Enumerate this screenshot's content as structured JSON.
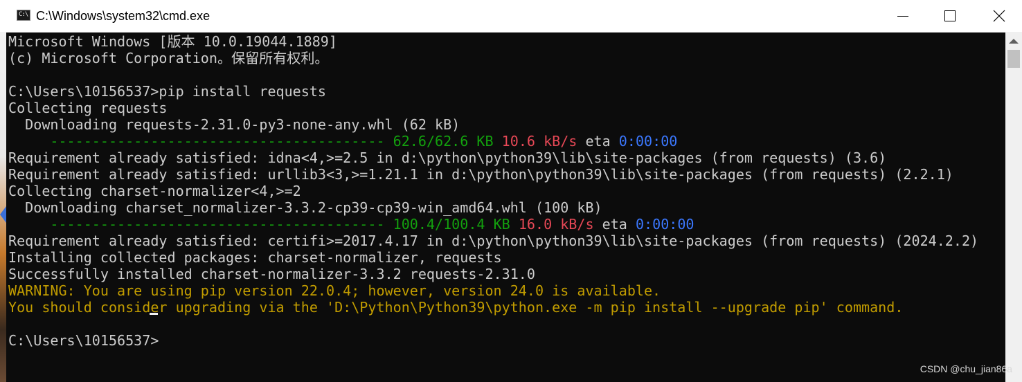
{
  "window": {
    "title": "C:\\Windows\\system32\\cmd.exe",
    "icon": "cmd-icon",
    "controls": {
      "minimize": "minimize-icon",
      "maximize": "maximize-icon",
      "close": "close-icon"
    }
  },
  "colors": {
    "background": "#0c0c0c",
    "text": "#cccccc",
    "green": "#13a10e",
    "red": "#e74856",
    "blue": "#3b78ff",
    "yellow": "#c19c00"
  },
  "console": {
    "lines": [
      [
        {
          "t": "Microsoft Windows [版本 10.0.19044.1889]",
          "c": "w"
        }
      ],
      [
        {
          "t": "(c) Microsoft Corporation。保留所有权利。",
          "c": "w"
        }
      ],
      [
        {
          "t": "",
          "c": "w"
        }
      ],
      [
        {
          "t": "C:\\Users\\10156537>pip install requests",
          "c": "w"
        }
      ],
      [
        {
          "t": "Collecting requests",
          "c": "w"
        }
      ],
      [
        {
          "t": "  Downloading requests-2.31.0-py3-none-any.whl (62 kB)",
          "c": "w"
        }
      ],
      [
        {
          "t": "     ---------------------------------------- ",
          "c": "g"
        },
        {
          "t": "62.6/62.6 KB",
          "c": "g"
        },
        {
          "t": " ",
          "c": "w"
        },
        {
          "t": "10.6 kB/s",
          "c": "r"
        },
        {
          "t": " eta ",
          "c": "w"
        },
        {
          "t": "0:00:00",
          "c": "b"
        }
      ],
      [
        {
          "t": "Requirement already satisfied: idna<4,>=2.5 in d:\\python\\python39\\lib\\site-packages (from requests) (3.6)",
          "c": "w"
        }
      ],
      [
        {
          "t": "Requirement already satisfied: urllib3<3,>=1.21.1 in d:\\python\\python39\\lib\\site-packages (from requests) (2.2.1)",
          "c": "w"
        }
      ],
      [
        {
          "t": "Collecting charset-normalizer<4,>=2",
          "c": "w"
        }
      ],
      [
        {
          "t": "  Downloading charset_normalizer-3.3.2-cp39-cp39-win_amd64.whl (100 kB)",
          "c": "w"
        }
      ],
      [
        {
          "t": "     ---------------------------------------- ",
          "c": "g"
        },
        {
          "t": "100.4/100.4 KB",
          "c": "g"
        },
        {
          "t": " ",
          "c": "w"
        },
        {
          "t": "16.0 kB/s",
          "c": "r"
        },
        {
          "t": " eta ",
          "c": "w"
        },
        {
          "t": "0:00:00",
          "c": "b"
        }
      ],
      [
        {
          "t": "Requirement already satisfied: certifi>=2017.4.17 in d:\\python\\python39\\lib\\site-packages (from requests) (2024.2.2)",
          "c": "w"
        }
      ],
      [
        {
          "t": "Installing collected packages: charset-normalizer, requests",
          "c": "w"
        }
      ],
      [
        {
          "t": "Successfully installed charset-normalizer-3.3.2 requests-2.31.0",
          "c": "w"
        }
      ],
      [
        {
          "t": "WARNING: You are using pip version 22.0.4; however, version 24.0 is available.",
          "c": "y"
        }
      ],
      [
        {
          "t": "You should consider upgrading via the 'D:\\Python\\Python39\\python.exe -m pip install --upgrade pip' command.",
          "c": "y"
        }
      ],
      [
        {
          "t": "",
          "c": "w"
        }
      ],
      [
        {
          "t": "C:\\Users\\10156537>",
          "c": "w"
        }
      ]
    ]
  },
  "watermark": "CSDN @chu_jian86a"
}
